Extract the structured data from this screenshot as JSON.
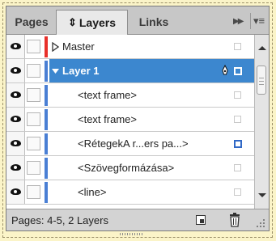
{
  "tabs": [
    {
      "label": "Pages",
      "active": false
    },
    {
      "label": "Layers",
      "active": true,
      "icon": "sort-arrows-icon"
    },
    {
      "label": "Links",
      "active": false
    }
  ],
  "tab_controls": {
    "collapse_icon": "double-chevron-right-icon",
    "menu_icon": "panel-menu-icon"
  },
  "layers": [
    {
      "label": "Master",
      "type": "layer",
      "expanded": false,
      "color": "#e8302a",
      "selected": false
    },
    {
      "label": "Layer 1",
      "type": "layer",
      "expanded": true,
      "color": "#4a7fd4",
      "selected": true
    },
    {
      "label": "<text frame>",
      "type": "item",
      "color": "#4a7fd4",
      "selected": false
    },
    {
      "label": "<text frame>",
      "type": "item",
      "color": "#4a7fd4",
      "selected": false
    },
    {
      "label": "<RétegekA r...ers pa...>",
      "type": "item",
      "color": "#4a7fd4",
      "selected": false,
      "target_selected": true
    },
    {
      "label": "<Szövegformázása>",
      "type": "item",
      "color": "#4a7fd4",
      "selected": false
    },
    {
      "label": "<line>",
      "type": "item",
      "color": "#4a7fd4",
      "selected": false
    }
  ],
  "footer": {
    "status": "Pages: 4-5, 2 Layers"
  },
  "colors": {
    "selection": "#3c87cf",
    "master_layer": "#e8302a",
    "layer_1": "#4a7fd4"
  }
}
